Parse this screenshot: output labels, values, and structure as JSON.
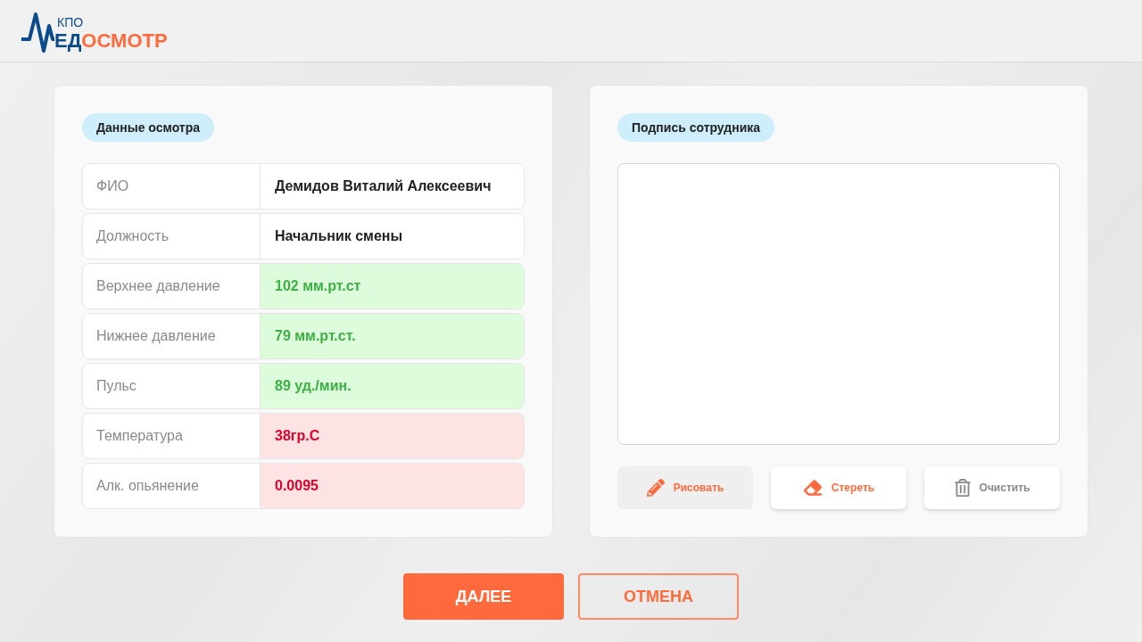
{
  "header": {
    "logo": {
      "caption": "КПО",
      "wordmark_part_1": "ЕД",
      "wordmark_part_2": "ОСМОТР"
    }
  },
  "exam_panel": {
    "title": "Данные осмотра",
    "rows": [
      {
        "label": "ФИО",
        "value": "Демидов Виталий Алексеевич",
        "kind": "info"
      },
      {
        "label": "Должность",
        "value": "Начальник смены",
        "kind": "info"
      },
      {
        "label": "Верхнее давление",
        "value": "102 мм.рт.ст",
        "kind": "normal"
      },
      {
        "label": "Нижнее давление",
        "value": "79 мм.рт.ст.",
        "kind": "normal"
      },
      {
        "label": "Пульс",
        "value": "89 уд./мин.",
        "kind": "normal"
      },
      {
        "label": "Температура",
        "value": "38гр.С",
        "kind": "abnormal"
      },
      {
        "label": "Алк. опьянение",
        "value": "0.0095",
        "kind": "abnormal"
      }
    ]
  },
  "signature_panel": {
    "title": "Подпись сотрудника",
    "tools": [
      {
        "label": "Рисовать",
        "kind": "tool",
        "selected": true
      },
      {
        "label": "Стереть",
        "kind": "tool",
        "selected": false
      },
      {
        "label": "Очистить",
        "kind": "action",
        "selected": false
      }
    ]
  },
  "actions": [
    {
      "label": "ДАЛЕЕ",
      "kind": "primary"
    },
    {
      "label": "ОТМЕНА",
      "kind": "secondary"
    }
  ]
}
